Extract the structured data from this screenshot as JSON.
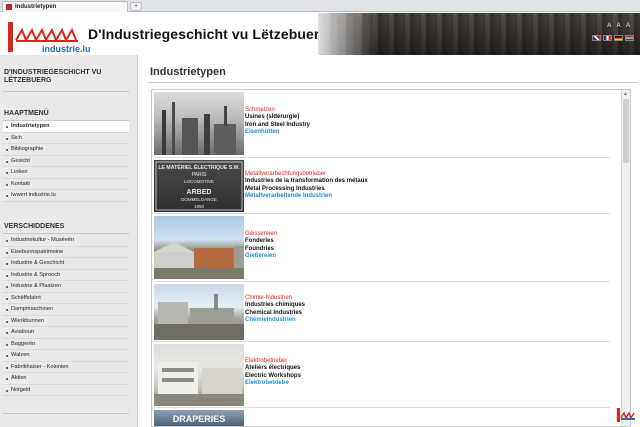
{
  "browser": {
    "tab_title": "Industrietypen",
    "new_tab": "+"
  },
  "header": {
    "logo_text": "industrie.lu",
    "site_title": "D'Industriegeschicht vu Lëtzebuerg",
    "tools": [
      "A",
      "A",
      "A"
    ],
    "languages": [
      "en",
      "fr",
      "de",
      "nl"
    ]
  },
  "sidebar": {
    "site_title": "D'INDUSTRIEGESCHICHT VU LËTZEBUERG",
    "main_menu_heading": "HAAPTMENÜ",
    "main_menu": [
      {
        "label": "Industrietypen",
        "active": true
      },
      {
        "label": "Sich",
        "active": false
      },
      {
        "label": "Bibliographie",
        "active": false
      },
      {
        "label": "Gesicht",
        "active": false
      },
      {
        "label": "Linken",
        "active": false
      },
      {
        "label": "Kontakt",
        "active": false
      },
      {
        "label": "Iwwert industrie.lu",
        "active": false
      }
    ],
    "misc_heading": "VERSCHIDDENES",
    "misc_menu": [
      "Industriekultur - Muséeën",
      "Eisebunnspatrimoine",
      "Industrie & Geschicht",
      "Industrie & Sprooch",
      "Industrie & Plaatzen",
      "Schëffsfahrt",
      "Dampmaschinen",
      "Wierkbunnen",
      "Aviatioun",
      "Baggerën",
      "Walzen",
      "Fabrikhaiser - Kolonien",
      "Aktien",
      "Notgeld"
    ]
  },
  "main": {
    "page_title": "Industrietypen",
    "items": [
      {
        "de": "Schmelzen",
        "fr": "Usines (sidérurgie)",
        "en": "Iron and Steel Industry",
        "lb": "Eisenhütten"
      },
      {
        "de": "Metallverarbechtungsbetrieber",
        "fr": "Industries de la transformation des métaux",
        "en": "Metal Processing Industries",
        "lb": "Metallverarbeitende Industrien"
      },
      {
        "de": "Géissereien",
        "fr": "Fonderies",
        "en": "Foundries",
        "lb": "Gießereien"
      },
      {
        "de": "Chimie-Industrien",
        "fr": "Industries chimiques",
        "en": "Chemical Industries",
        "lb": "Chemieindustrien"
      },
      {
        "de": "Elektrobetrieber",
        "fr": "Ateliers électriques",
        "en": "Electric Workshops",
        "lb": "Elektrobetriebe"
      }
    ],
    "sign_text": [
      "LE MATÉRIEL ÉLECTRIQUE S.W.",
      "PARIS",
      "LOCOMOTIVE",
      "ARBED",
      "DOMMELDANGE",
      "1950"
    ],
    "partial_image_text": "DRAPERIES"
  },
  "colors": {
    "accent_red": "#e0231d",
    "link_blue": "#1c8fcf",
    "sidebar_bg": "#e9e9e9"
  }
}
